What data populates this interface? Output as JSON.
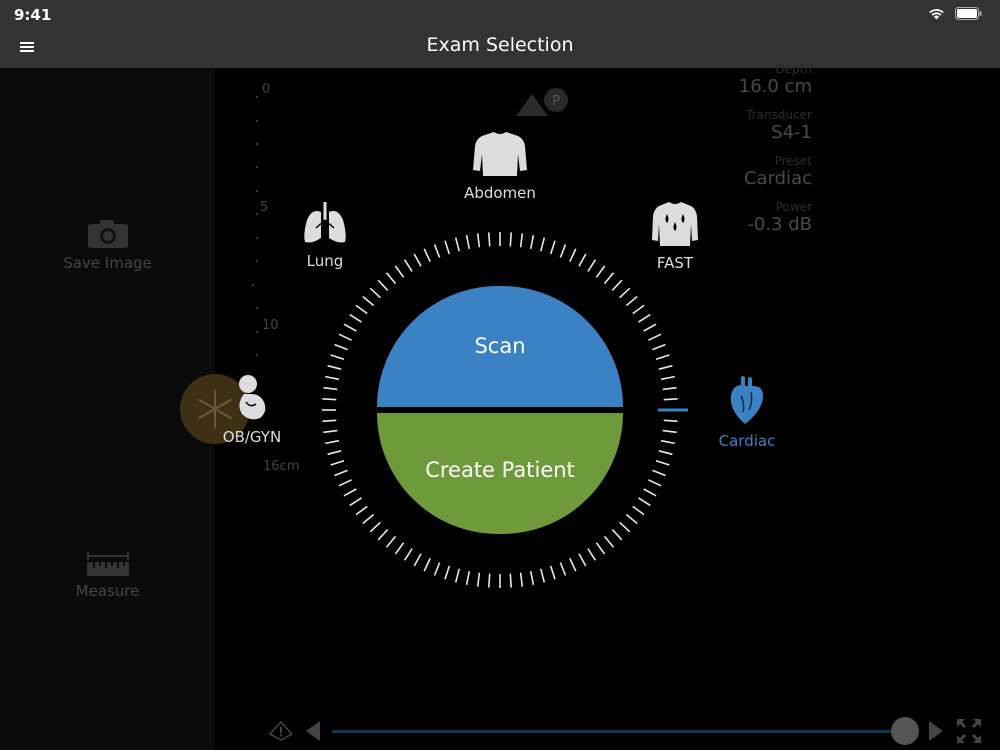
{
  "status": {
    "time": "9:41"
  },
  "nav": {
    "title": "Exam Selection"
  },
  "sidebar": {
    "save_label": "Save Image",
    "measure_label": "Measure"
  },
  "ruler": {
    "labels": [
      "0",
      "5",
      "10"
    ],
    "depth_label": "16cm"
  },
  "info": {
    "depth_caption": "Depth",
    "depth_value": "16.0 cm",
    "transducer_caption": "Transducer",
    "transducer_value": "S4-1",
    "preset_caption": "Preset",
    "preset_value": "Cardiac",
    "power_caption": "Power",
    "power_value": "-0.3 dB"
  },
  "exams": {
    "abdomen": "Abdomen",
    "lung": "Lung",
    "fast": "FAST",
    "obgyn": "OB/GYN",
    "cardiac": "Cardiac"
  },
  "actions": {
    "scan": "Scan",
    "create_patient": "Create Patient"
  },
  "colors": {
    "scan": "#3a82c4",
    "patient": "#6f9a3b",
    "selected": "#3a82c4",
    "bar": "#333333"
  }
}
